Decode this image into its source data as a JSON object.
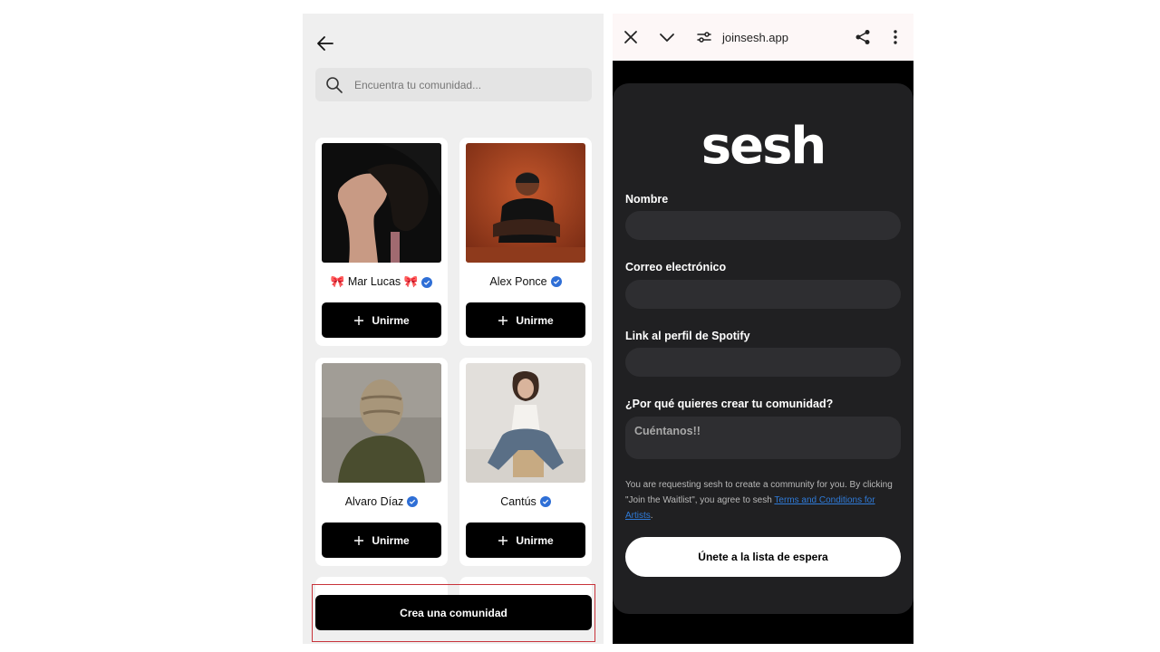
{
  "left_screen": {
    "search": {
      "placeholder": "Encuentra tu comunidad..."
    },
    "cards": [
      {
        "name": "🎀 Mar Lucas 🎀",
        "join_label": "Unirme"
      },
      {
        "name": "Alex Ponce",
        "join_label": "Unirme"
      },
      {
        "name": "Alvaro Díaz",
        "join_label": "Unirme"
      },
      {
        "name": "Cantús",
        "join_label": "Unirme"
      }
    ],
    "create_label": "Crea una comunidad"
  },
  "right_screen": {
    "browser": {
      "url": "joinsesh.app"
    },
    "logo_text": "sesh",
    "form": {
      "name_label": "Nombre",
      "email_label": "Correo electrónico",
      "spotify_label": "Link al perfil de Spotify",
      "why_label": "¿Por qué quieres crear tu comunidad?",
      "why_placeholder": "Cuéntanos!!"
    },
    "legal_text": "You are requesting sesh to create a community for you. By clicking \"Join the Waitlist\", you agree to sesh ",
    "legal_link": "Terms and Conditions for Artists",
    "legal_end": ".",
    "submit_label": "Únete a la lista de espera"
  },
  "colors": {
    "verified": "#2f6fd6",
    "panel": "#202022",
    "link": "#2f7bd9"
  }
}
